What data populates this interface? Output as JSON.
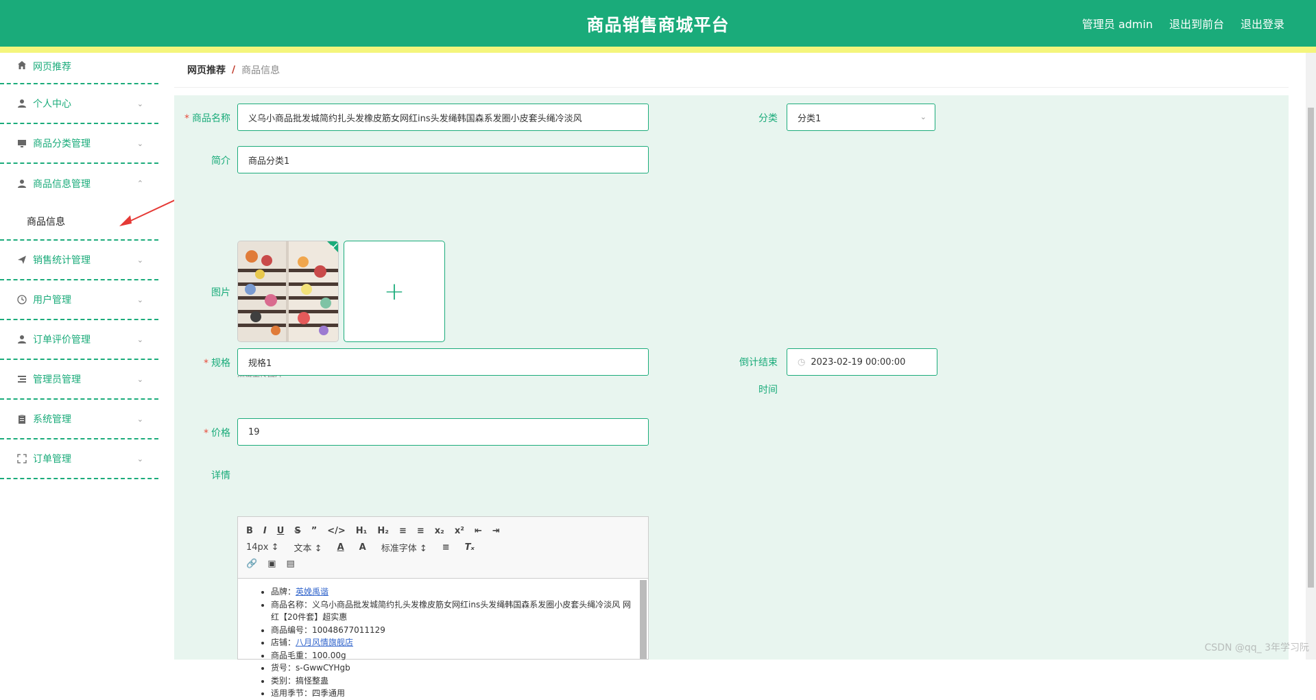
{
  "header": {
    "title": "商品销售商城平台",
    "admin_label": "管理员 admin",
    "frontend_link": "退出到前台",
    "logout_link": "退出登录"
  },
  "sidebar": {
    "items": [
      {
        "label": "网页推荐",
        "icon": "home-icon"
      },
      {
        "label": "个人中心",
        "icon": "user-icon"
      },
      {
        "label": "商品分类管理",
        "icon": "monitor-icon"
      },
      {
        "label": "商品信息管理",
        "icon": "user-icon"
      },
      {
        "label": "商品信息",
        "icon": ""
      },
      {
        "label": "销售统计管理",
        "icon": "send-icon"
      },
      {
        "label": "用户管理",
        "icon": "clock-icon"
      },
      {
        "label": "订单评价管理",
        "icon": "user-icon"
      },
      {
        "label": "管理员管理",
        "icon": "list-icon"
      },
      {
        "label": "系统管理",
        "icon": "clipboard-icon"
      },
      {
        "label": "订单管理",
        "icon": "fullscreen-icon"
      }
    ]
  },
  "breadcrumb": {
    "home": "网页推荐",
    "separator": "/",
    "current": "商品信息"
  },
  "form": {
    "name_label": "商品名称",
    "name_value": "义乌小商品批发城简约扎头发橡皮筋女网红ins头发绳韩国森系发圈小皮套头绳冷淡风",
    "category_label": "分类",
    "category_value": "分类1",
    "intro_label": "简介",
    "intro_value": "商品分类1",
    "image_label": "图片",
    "upload_hint": "点击上传图片",
    "spec_label": "规格",
    "spec_value": "规格1",
    "countdown_label_1": "倒计结束",
    "countdown_label_2": "时间",
    "countdown_value": "2023-02-19 00:00:00",
    "price_label": "价格",
    "price_value": "19",
    "detail_label": "详情"
  },
  "editor": {
    "font_size": "14px",
    "text_type": "文本",
    "font_family": "标准字体",
    "lines": [
      {
        "key": "品牌：",
        "value": "英娩禹谐",
        "link": true
      },
      {
        "key": "商品名称：",
        "value": "义乌小商品批发城简约扎头发橡皮筋女网红ins头发绳韩国森系发圈小皮套头绳冷淡风 网红【20件套】超实惠",
        "link": false
      },
      {
        "key": "商品编号：",
        "value": "10048677011129",
        "link": false
      },
      {
        "key": "店铺：",
        "value": "八月风情旗舰店",
        "link": true
      },
      {
        "key": "商品毛重：",
        "value": "100.00g",
        "link": false
      },
      {
        "key": "货号：",
        "value": "s-GwwCYHgb",
        "link": false
      },
      {
        "key": "类别：",
        "value": "搞怪整蛊",
        "link": false
      },
      {
        "key": "适用季节：",
        "value": "四季通用",
        "link": false
      }
    ]
  },
  "watermark": "CSDN @qq_ 3年学习阮"
}
